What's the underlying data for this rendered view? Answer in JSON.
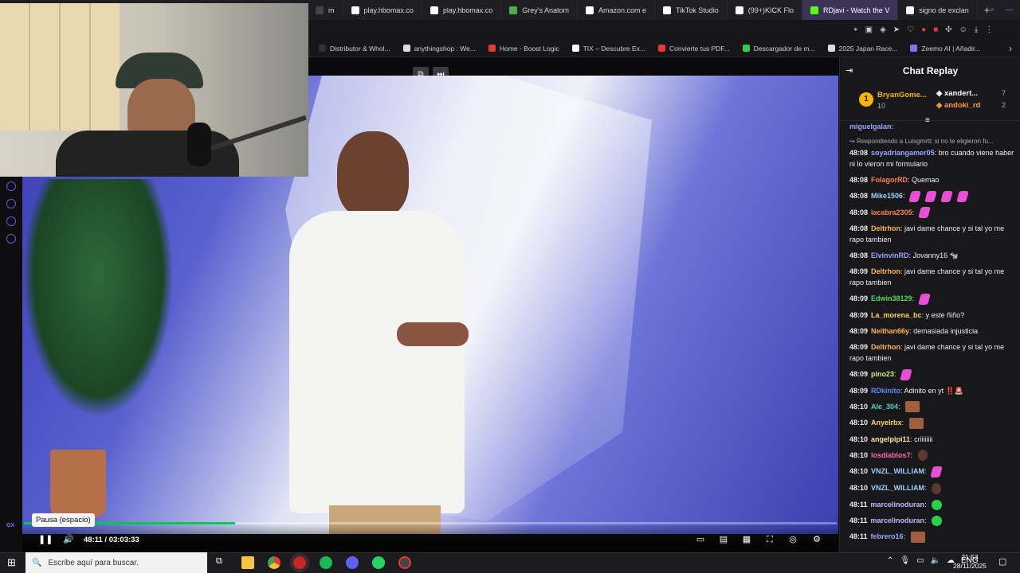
{
  "browser": {
    "tabs": [
      {
        "label": "m",
        "color": "#444"
      },
      {
        "label": "play.hbomax.co",
        "color": "#fff"
      },
      {
        "label": "play.hbomax.co",
        "color": "#fff"
      },
      {
        "label": "Grey's Anatom",
        "color": "#4caf50"
      },
      {
        "label": "Amazon.com e",
        "color": "#fff"
      },
      {
        "label": "TikTok Studio",
        "color": "#fff"
      },
      {
        "label": "(99+)KICK Flo",
        "color": "#fff"
      },
      {
        "label": "RDjavi - Watch the V",
        "color": "#53fc18",
        "active": true
      },
      {
        "label": "signo de exclan",
        "color": "#fff"
      }
    ],
    "bookmarks": [
      {
        "label": "Distributor & Whol...",
        "color": "#333"
      },
      {
        "label": "anythingshop : We...",
        "color": "#ddd"
      },
      {
        "label": "Home - Boost Logic",
        "color": "#e53935"
      },
      {
        "label": "TIX – Descubre Ex...",
        "color": "#fff"
      },
      {
        "label": "Convierte tus PDF...",
        "color": "#e53935"
      },
      {
        "label": "Descargador de m...",
        "color": "#2bd14b"
      },
      {
        "label": "2025 Japan Race...",
        "color": "#ddd"
      },
      {
        "label": "Zeemo AI | Añadir...",
        "color": "#8e6cf0"
      }
    ]
  },
  "player": {
    "tooltip": "Pausa (espacio)",
    "timecode": "48:11 / 03:03:33",
    "progress": 0.26,
    "rail_label": "GX"
  },
  "chat": {
    "title": "Chat Replay",
    "leaderboard": [
      {
        "rank": "1",
        "name": "BryanGome...",
        "count": "10"
      },
      {
        "name": "xandert...",
        "count": "7"
      },
      {
        "name": "andoki_rd",
        "count": "2"
      }
    ],
    "reply_text": "Respondiendo a Luisgmrtt: si no te eligieron fu...",
    "top_user": "miguelgalan:",
    "messages": [
      {
        "ts": "48:08",
        "user": "soyadriangamer05",
        "color": "#9aa6ff",
        "text": "bro cuando viene haber ni lo vieron mi formulario"
      },
      {
        "ts": "48:08",
        "user": "FolagorRD",
        "color": "#ff7f50",
        "text": "Quemao"
      },
      {
        "ts": "48:08",
        "user": "Mike1506",
        "color": "#9ad0ff",
        "text": "",
        "emotes": 4
      },
      {
        "ts": "48:08",
        "user": "lacabra2305",
        "color": "#ff7f50",
        "text": "",
        "emotes": 1
      },
      {
        "ts": "48:08",
        "user": "Deltrhon",
        "color": "#ffb347",
        "text": "javi dame chance y si tal yo me rapo tambien"
      },
      {
        "ts": "48:08",
        "user": "ElvinvinRD",
        "color": "#9aa6ff",
        "text": "Jovanny16 🐄"
      },
      {
        "ts": "48:09",
        "user": "Deltrhon",
        "color": "#ffb347",
        "text": "javi dame chance y si tal yo me rapo tambien"
      },
      {
        "ts": "48:09",
        "user": "Edwin38129",
        "color": "#4cd964",
        "text": "",
        "emotes": 1
      },
      {
        "ts": "48:09",
        "user": "La_morena_bc",
        "color": "#ffd54f",
        "text": "y este ñiño?"
      },
      {
        "ts": "48:09",
        "user": "Neithan66y",
        "color": "#ffb347",
        "text": "demasiada injusticia"
      },
      {
        "ts": "48:09",
        "user": "Deltrhon",
        "color": "#ffb347",
        "text": "javi dame chance y si tal yo me rapo tambien"
      },
      {
        "ts": "48:09",
        "user": "pino23",
        "color": "#c5f06b",
        "text": "",
        "emotes": 1
      },
      {
        "ts": "48:09",
        "user": "RDkinito",
        "color": "#5b8cff",
        "text": "Adinito en yt ‼️🚨"
      },
      {
        "ts": "48:10",
        "user": "Ale_304",
        "color": "#4cd9c0",
        "text": "",
        "emotes": 1,
        "kind": "face"
      },
      {
        "ts": "48:10",
        "user": "Anyelrbx",
        "color": "#ffd54f",
        "text": "",
        "emotes": 1,
        "kind": "face"
      },
      {
        "ts": "48:10",
        "user": "angelpipi11",
        "color": "#ffe0a0",
        "text": "criiiiiiii"
      },
      {
        "ts": "48:10",
        "user": "losdiablos7",
        "color": "#ff69b4",
        "text": "",
        "emotes": 1,
        "kind": "brown"
      },
      {
        "ts": "48:10",
        "user": "VNZL_WILLIAM",
        "color": "#9ad0ff",
        "text": "",
        "emotes": 1
      },
      {
        "ts": "48:10",
        "user": "VNZL_WILLIAM",
        "color": "#9ad0ff",
        "text": "",
        "emotes": 1,
        "kind": "brown"
      },
      {
        "ts": "48:11",
        "user": "marcelinoduran",
        "color": "#c7b4ff",
        "text": "",
        "emotes": 1,
        "kind": "green"
      },
      {
        "ts": "48:11",
        "user": "marcelinoduran",
        "color": "#c7b4ff",
        "text": "",
        "emotes": 1,
        "kind": "green"
      },
      {
        "ts": "48:11",
        "user": "febrero16",
        "color": "#9aa6ff",
        "text": "",
        "emotes": 1,
        "kind": "face"
      }
    ]
  },
  "taskbar": {
    "search_placeholder": "Escribe aquí para buscar.",
    "lang": "ENG",
    "time": "21:53",
    "date": "28/11/2025"
  }
}
